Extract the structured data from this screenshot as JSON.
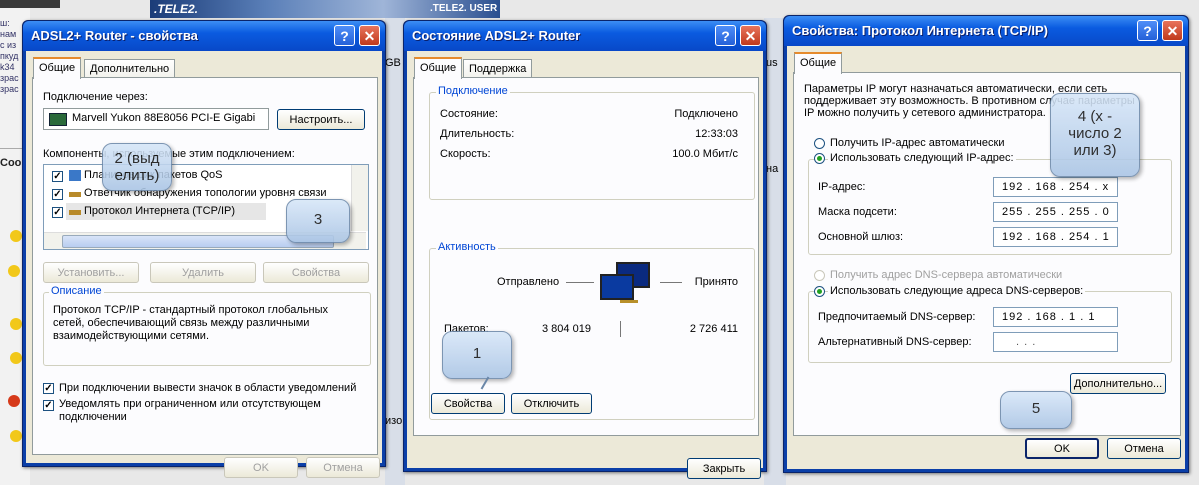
{
  "background": {
    "left_fragments": [
      "ш:",
      "нам",
      "с из",
      "пкуд",
      "k34",
      "зрас",
      "зрас"
    ],
    "left_heading": "Coo",
    "banner_text": ".TELE2.",
    "banner_right": ".TELE2. USER",
    "gap_text_1": "GB",
    "gap_text_2": "us",
    "gap_text_3": "изо",
    "gap_text_4": "на"
  },
  "win1": {
    "title": "ADSL2+ Router - свойства",
    "help": "?",
    "close": "✕",
    "tabs": [
      "Общие",
      "Дополнительно"
    ],
    "connect_via_label": "Подключение через:",
    "adapter_name": "Marvell Yukon 88E8056 PCI-E Gigabi",
    "configure_button": "Настроить...",
    "components_label": "Компоненты, используемые этим подключением:",
    "components": [
      {
        "name": "Планировщик пакетов QoS",
        "checked": true
      },
      {
        "name": "Ответчик обнаружения топологии уровня связи",
        "checked": true
      },
      {
        "name": "Протокол Интернета (TCP/IP)",
        "checked": true
      }
    ],
    "install_button": "Установить...",
    "uninstall_button": "Удалить",
    "properties_button": "Свойства",
    "description_label": "Описание",
    "description_text": "Протокол TCP/IP - стандартный протокол глобальных сетей, обеспечивающий связь между различными взаимодействующими сетями.",
    "show_icon_label": "При подключении вывести значок в области уведомлений",
    "notify_label": "Уведомлять при ограниченном или отсутствующем подключении",
    "ok_button": "OK",
    "cancel_button": "Отмена"
  },
  "win2": {
    "title": "Состояние ADSL2+ Router",
    "help": "?",
    "close": "✕",
    "tabs": [
      "Общие",
      "Поддержка"
    ],
    "connection_group": "Подключение",
    "status_label": "Состояние:",
    "status_value": "Подключено",
    "duration_label": "Длительность:",
    "duration_value": "12:33:03",
    "speed_label": "Скорость:",
    "speed_value": "100.0 Мбит/с",
    "activity_group": "Активность",
    "sent_label": "Отправлено",
    "received_label": "Принято",
    "packets_label": "Пакетов:",
    "packets_sent": "3 804 019",
    "packets_received": "2 726 411",
    "properties_button": "Свойства",
    "disconnect_button": "Отключить",
    "close_button": "Закрыть"
  },
  "win3": {
    "title": "Свойства: Протокол Интернета (TCP/IP)",
    "help": "?",
    "close": "✕",
    "tabs": [
      "Общие"
    ],
    "info_text_1": "Параметры IP могут назначаться автоматически, если сеть",
    "info_text_2": "поддерживает эту возможность. В противном случае параметры",
    "info_text_3": "IP можно получить у сетевого администратора.",
    "auto_ip_label": "Получить IP-адрес автоматически",
    "manual_ip_label": "Использовать следующий IP-адрес:",
    "ip_label": "IP-адрес:",
    "ip_value": "192 . 168 . 254 .  x",
    "mask_label": "Маска подсети:",
    "mask_value": "255 . 255 . 255 .  0",
    "gateway_label": "Основной шлюз:",
    "gateway_value": "192 . 168 . 254 .  1",
    "auto_dns_label": "Получить адрес DNS-сервера автоматически",
    "manual_dns_label": "Использовать следующие адреса DNS-серверов:",
    "preferred_dns_label": "Предпочитаемый DNS-сервер:",
    "preferred_dns_value": "192 . 168 .  1  .  1",
    "alternate_dns_label": "Альтернативный DNS-сервер:",
    "alternate_dns_value": ".      .      .",
    "advanced_button": "Дополнительно...",
    "ok_button": "OK",
    "cancel_button": "Отмена"
  },
  "callouts": {
    "c1": "1",
    "c2_line1": "2 (выд",
    "c2_line2": "елить)",
    "c3": "3",
    "c4_line1": "4 (х -",
    "c4_line2": "число 2",
    "c4_line3": "или 3)",
    "c5": "5"
  }
}
